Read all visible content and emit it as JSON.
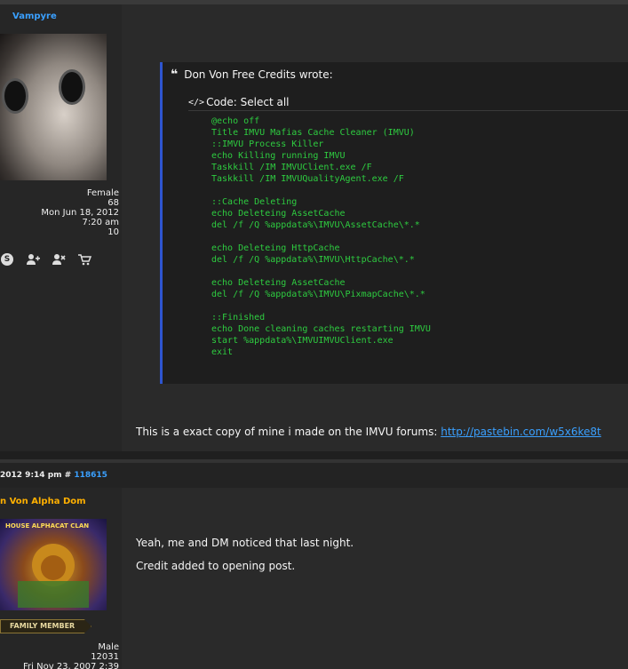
{
  "post1": {
    "user": {
      "name": "Vampyre",
      "gender": "Female",
      "posts": "68",
      "joined_date": "Mon Jun 18, 2012",
      "joined_time": "7:20 am",
      "reputation": "10",
      "contact_icons": [
        "skype-icon",
        "add-friend-icon",
        "remove-friend-icon",
        "cart-icon"
      ]
    },
    "quote": {
      "author_line": "Don Von Free Credits wrote:",
      "code_label": "Code: Select all",
      "code": "@echo off\nTitle IMVU Mafias Cache Cleaner (IMVU)\n::IMVU Process Killer\necho Killing running IMVU\nTaskkill /IM IMVUClient.exe /F\nTaskkill /IM IMVUQualityAgent.exe /F\n\n::Cache Deleting\necho Deleteing AssetCache\ndel /f /Q %appdata%\\IMVU\\AssetCache\\*.*\n\necho Deleteing HttpCache\ndel /f /Q %appdata%\\IMVU\\HttpCache\\*.*\n\necho Deleteing AssetCache\ndel /f /Q %appdata%\\IMVU\\PixmapCache\\*.*\n\n::Finished\necho Done cleaning caches restarting IMVU\nstart %appdata%\\IMVUIMVUClient.exe\nexit"
    },
    "message": "This is a exact copy of mine i made on the IMVU forums: ",
    "link_text": "http://pastebin.com/w5x6ke8t"
  },
  "post2": {
    "meta_date": "2012 9:14 pm #",
    "meta_id": "118615",
    "user": {
      "name": "n Von Alpha Dom",
      "avatar_caption": "HOUSE ALPHACAT CLAN",
      "badge": "FAMILY MEMBER",
      "gender": "Male",
      "posts": "12031",
      "joined": "Fri Nov 23, 2007 2:39"
    },
    "line1": "Yeah, me and DM noticed that last night.",
    "line2": "Credit added to opening post."
  },
  "colors": {
    "username_blue": "#3aa0ff",
    "username_gold": "#ffb000",
    "code_green": "#2ecc40",
    "quote_border": "#2e55d0"
  }
}
